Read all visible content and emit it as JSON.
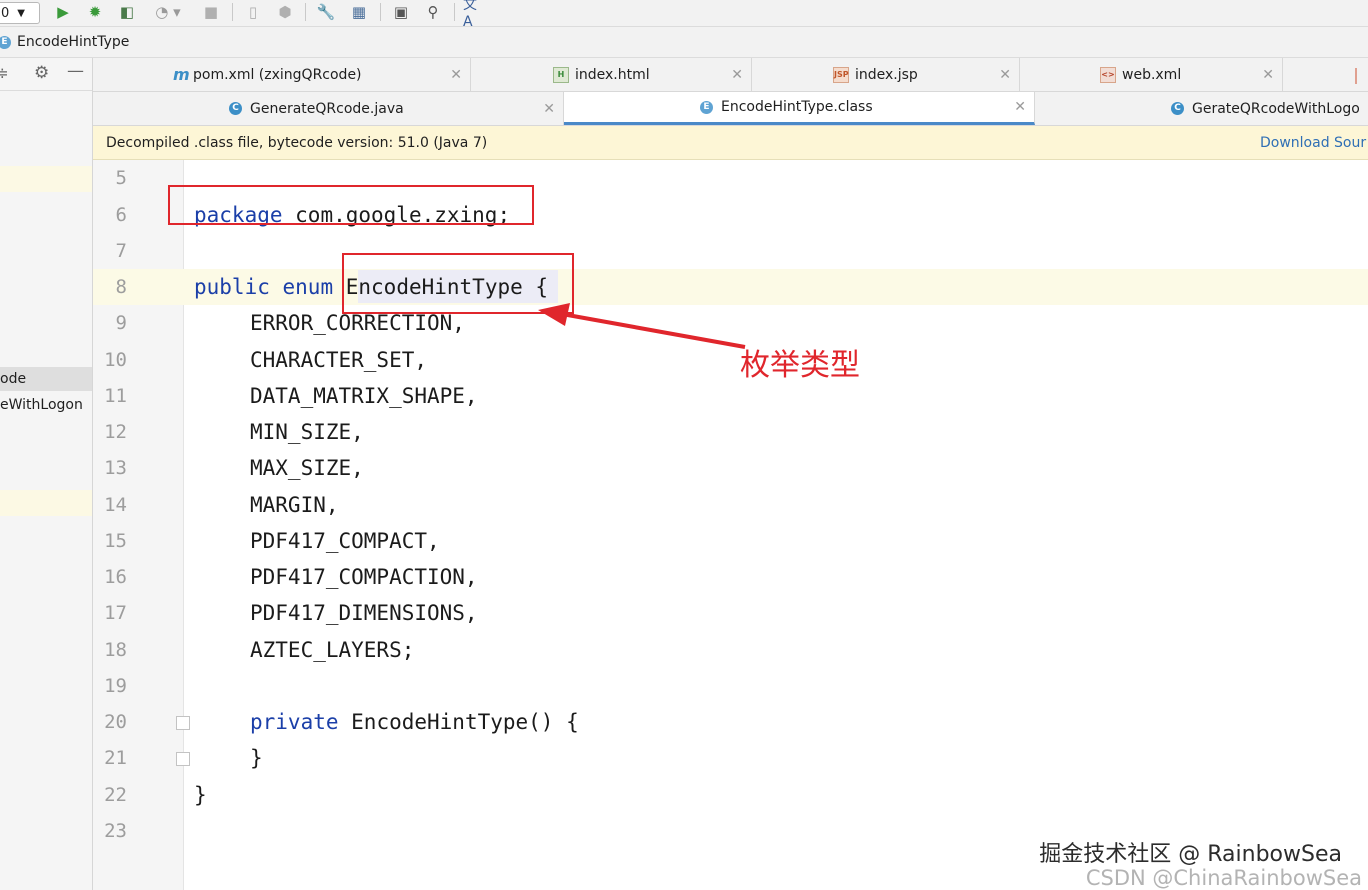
{
  "toolbar": {
    "run_config_value": "0",
    "icons": [
      "run-icon",
      "debug-icon",
      "coverage-icon",
      "profile-icon",
      "stop-icon",
      "attach-icon",
      "build-icon",
      "settings-wrench-icon",
      "project-structure-icon",
      "terminal-icon",
      "search-icon",
      "translate-icon"
    ]
  },
  "breadcrumb": {
    "label": "EncodeHintType"
  },
  "project_panel": {
    "items": [
      {
        "label": "ode"
      },
      {
        "label": "eWithLogon"
      }
    ]
  },
  "tabs_row1": [
    {
      "label": "pom.xml (zxingQRcode)",
      "icon": "maven-icon"
    },
    {
      "label": "index.html",
      "icon": "html-file-icon"
    },
    {
      "label": "index.jsp",
      "icon": "jsp-file-icon"
    },
    {
      "label": "web.xml",
      "icon": "xml-file-icon"
    }
  ],
  "tabs_row2": [
    {
      "label": "GenerateQRcode.java",
      "icon": "class-icon"
    },
    {
      "label": "EncodeHintType.class",
      "icon": "enum-icon",
      "active": true
    },
    {
      "label": "GerateQRcodeWithLogo",
      "icon": "class-icon"
    }
  ],
  "banner": {
    "message": "Decompiled .class file, bytecode version: 51.0 (Java 7)",
    "link": "Download Sour"
  },
  "editor": {
    "line_numbers": [
      "5",
      "6",
      "7",
      "8",
      "9",
      "10",
      "11",
      "12",
      "13",
      "14",
      "15",
      "16",
      "17",
      "18",
      "19",
      "20",
      "21",
      "22",
      "23"
    ],
    "lines": {
      "package_kw": "package",
      "package_name": " com.google.zxing;",
      "public_kw": "public",
      "enum_kw": "enum",
      "enum_name": "EncodeHintType",
      "open_brace": " {",
      "constants": [
        "ERROR_CORRECTION,",
        "CHARACTER_SET,",
        "DATA_MATRIX_SHAPE,",
        "MIN_SIZE,",
        "MAX_SIZE,",
        "MARGIN,",
        "PDF417_COMPACT,",
        "PDF417_COMPACTION,",
        "PDF417_DIMENSIONS,",
        "AZTEC_LAYERS;"
      ],
      "private_kw": "private",
      "constructor": " EncodeHintType() {",
      "close_inner": "}",
      "close_outer": "}"
    }
  },
  "annotation": {
    "label": "枚举类型",
    "color": "#e0262c"
  },
  "watermark": {
    "primary": "掘金技术社区 @ RainbowSea",
    "secondary": "CSDN @ChinaRainbowSea"
  }
}
